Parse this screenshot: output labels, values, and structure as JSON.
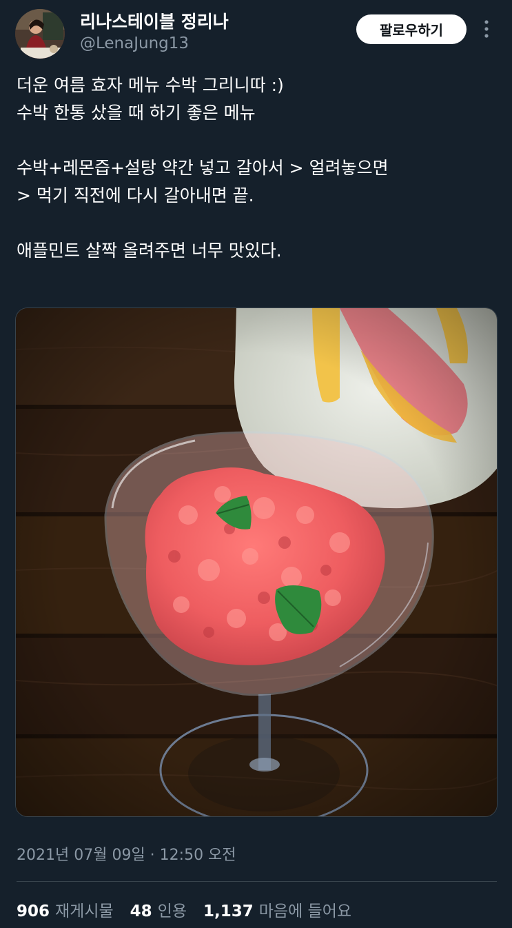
{
  "author": {
    "display_name": "리나스테이블 정리나",
    "handle": "@LenaJung13"
  },
  "follow_button_label": "팔로우하기",
  "tweet": {
    "lines": [
      "더운 여름 효자 메뉴 수박 그리니따 :)",
      "수박 한통 샀을 때 하기 좋은 메뉴",
      "수박+레몬즙+설탕 약간 넣고 갈아서 > 얼려놓으면",
      "> 먹기 직전에 다시 갈아내면 끝.",
      "애플민트 살짝 올려주면 너무 맛있다."
    ]
  },
  "media": {
    "description_icon": "photo-watermelon-granita"
  },
  "timestamp": "2021년 07월 09일 · 12:50 오전",
  "stats": {
    "retweets": {
      "count": "906",
      "label": "재게시물"
    },
    "quotes": {
      "count": "48",
      "label": "인용"
    },
    "likes": {
      "count": "1,137",
      "label": "마음에 들어요"
    }
  },
  "colors": {
    "background": "#15202b",
    "secondary_text": "#8b98a5",
    "divider": "#38444d"
  }
}
